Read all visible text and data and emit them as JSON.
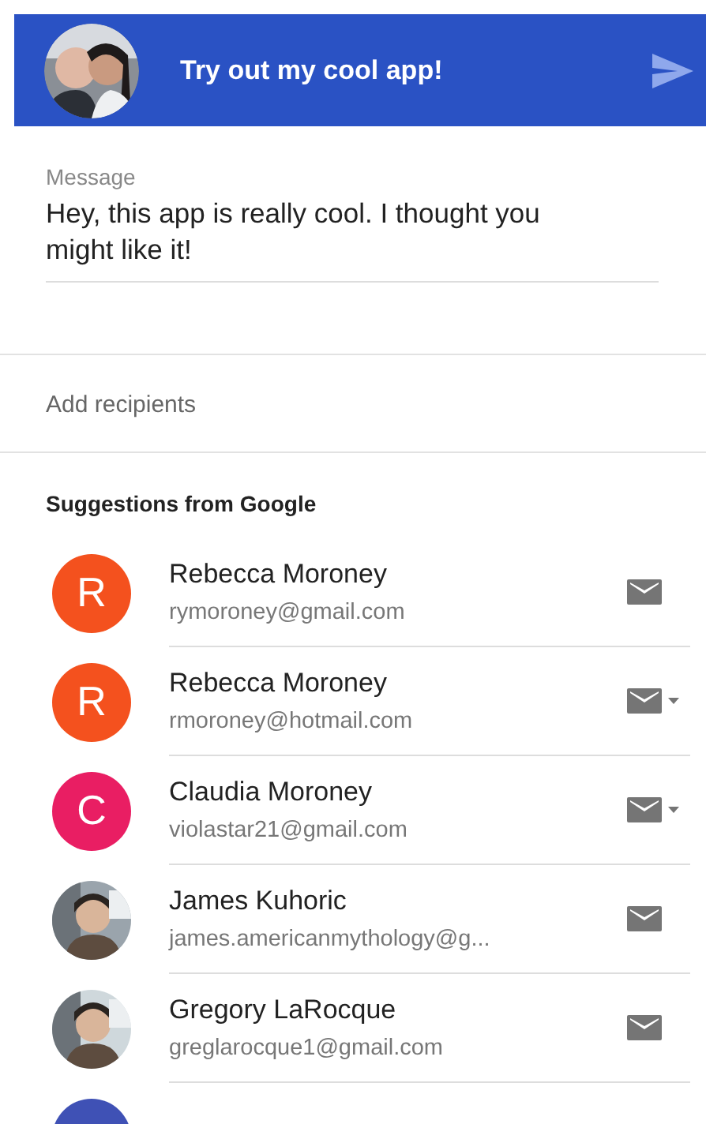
{
  "header": {
    "title": "Try out my cool app!"
  },
  "message": {
    "label": "Message",
    "value": "Hey, this app is really cool. I thought you might like it!"
  },
  "recipients": {
    "placeholder": "Add recipients"
  },
  "suggestions": {
    "heading": "Suggestions from Google",
    "contacts": [
      {
        "kind": "letter",
        "letter": "R",
        "color": "#f4511e",
        "name": "Rebecca Moroney",
        "email": "rymoroney@gmail.com",
        "has_options": false
      },
      {
        "kind": "letter",
        "letter": "R",
        "color": "#f4511e",
        "name": "Rebecca Moroney",
        "email": "rmoroney@hotmail.com",
        "has_options": true
      },
      {
        "kind": "letter",
        "letter": "C",
        "color": "#e91e63",
        "name": "Claudia Moroney",
        "email": "violastar21@gmail.com",
        "has_options": true
      },
      {
        "name": "James Kuhoric",
        "email": "james.americanmythology@g...",
        "has_options": false
      },
      {
        "name": "Gregory LaRocque",
        "email": "greglarocque1@gmail.com",
        "has_options": false
      },
      {
        "kind": "cut",
        "color": "#3f51b5"
      }
    ]
  }
}
